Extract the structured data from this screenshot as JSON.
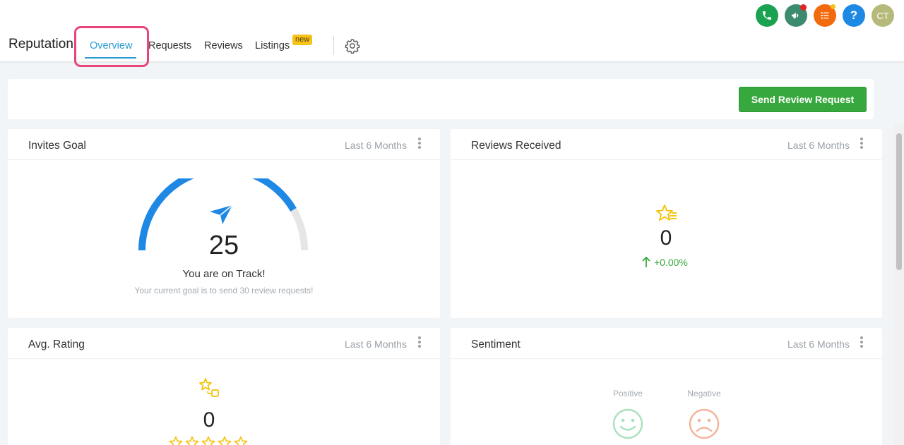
{
  "app": {
    "title": "Reputation"
  },
  "tabs": [
    {
      "label": "Overview",
      "active": true
    },
    {
      "label": "Requests"
    },
    {
      "label": "Reviews"
    },
    {
      "label": "Listings",
      "badge": "new"
    }
  ],
  "topbar": {
    "avatar_initials": "CT",
    "help_label": "?",
    "icons": [
      "phone-icon",
      "megaphone-icon",
      "list-icon",
      "help-icon",
      "avatar"
    ]
  },
  "toolbar": {
    "send_label": "Send Review Request"
  },
  "cards": {
    "invites_goal": {
      "title": "Invites Goal",
      "period": "Last 6 Months",
      "value": "25",
      "status": "You are on Track!",
      "note": "Your current goal is to send 30 review requests!",
      "progress": 0.833
    },
    "reviews_received": {
      "title": "Reviews Received",
      "period": "Last 6 Months",
      "value": "0",
      "trend": "+0.00%"
    },
    "avg_rating": {
      "title": "Avg. Rating",
      "period": "Last 6 Months",
      "value": "0",
      "stars": 5
    },
    "sentiment": {
      "title": "Sentiment",
      "period": "Last 6 Months",
      "positive_label": "Positive",
      "negative_label": "Negative"
    }
  },
  "colors": {
    "accent": "#2a9bd3",
    "primary_button": "#37a83d",
    "highlight": "#e8457a",
    "gauge": "#1e88e5",
    "star": "#f2c200"
  }
}
